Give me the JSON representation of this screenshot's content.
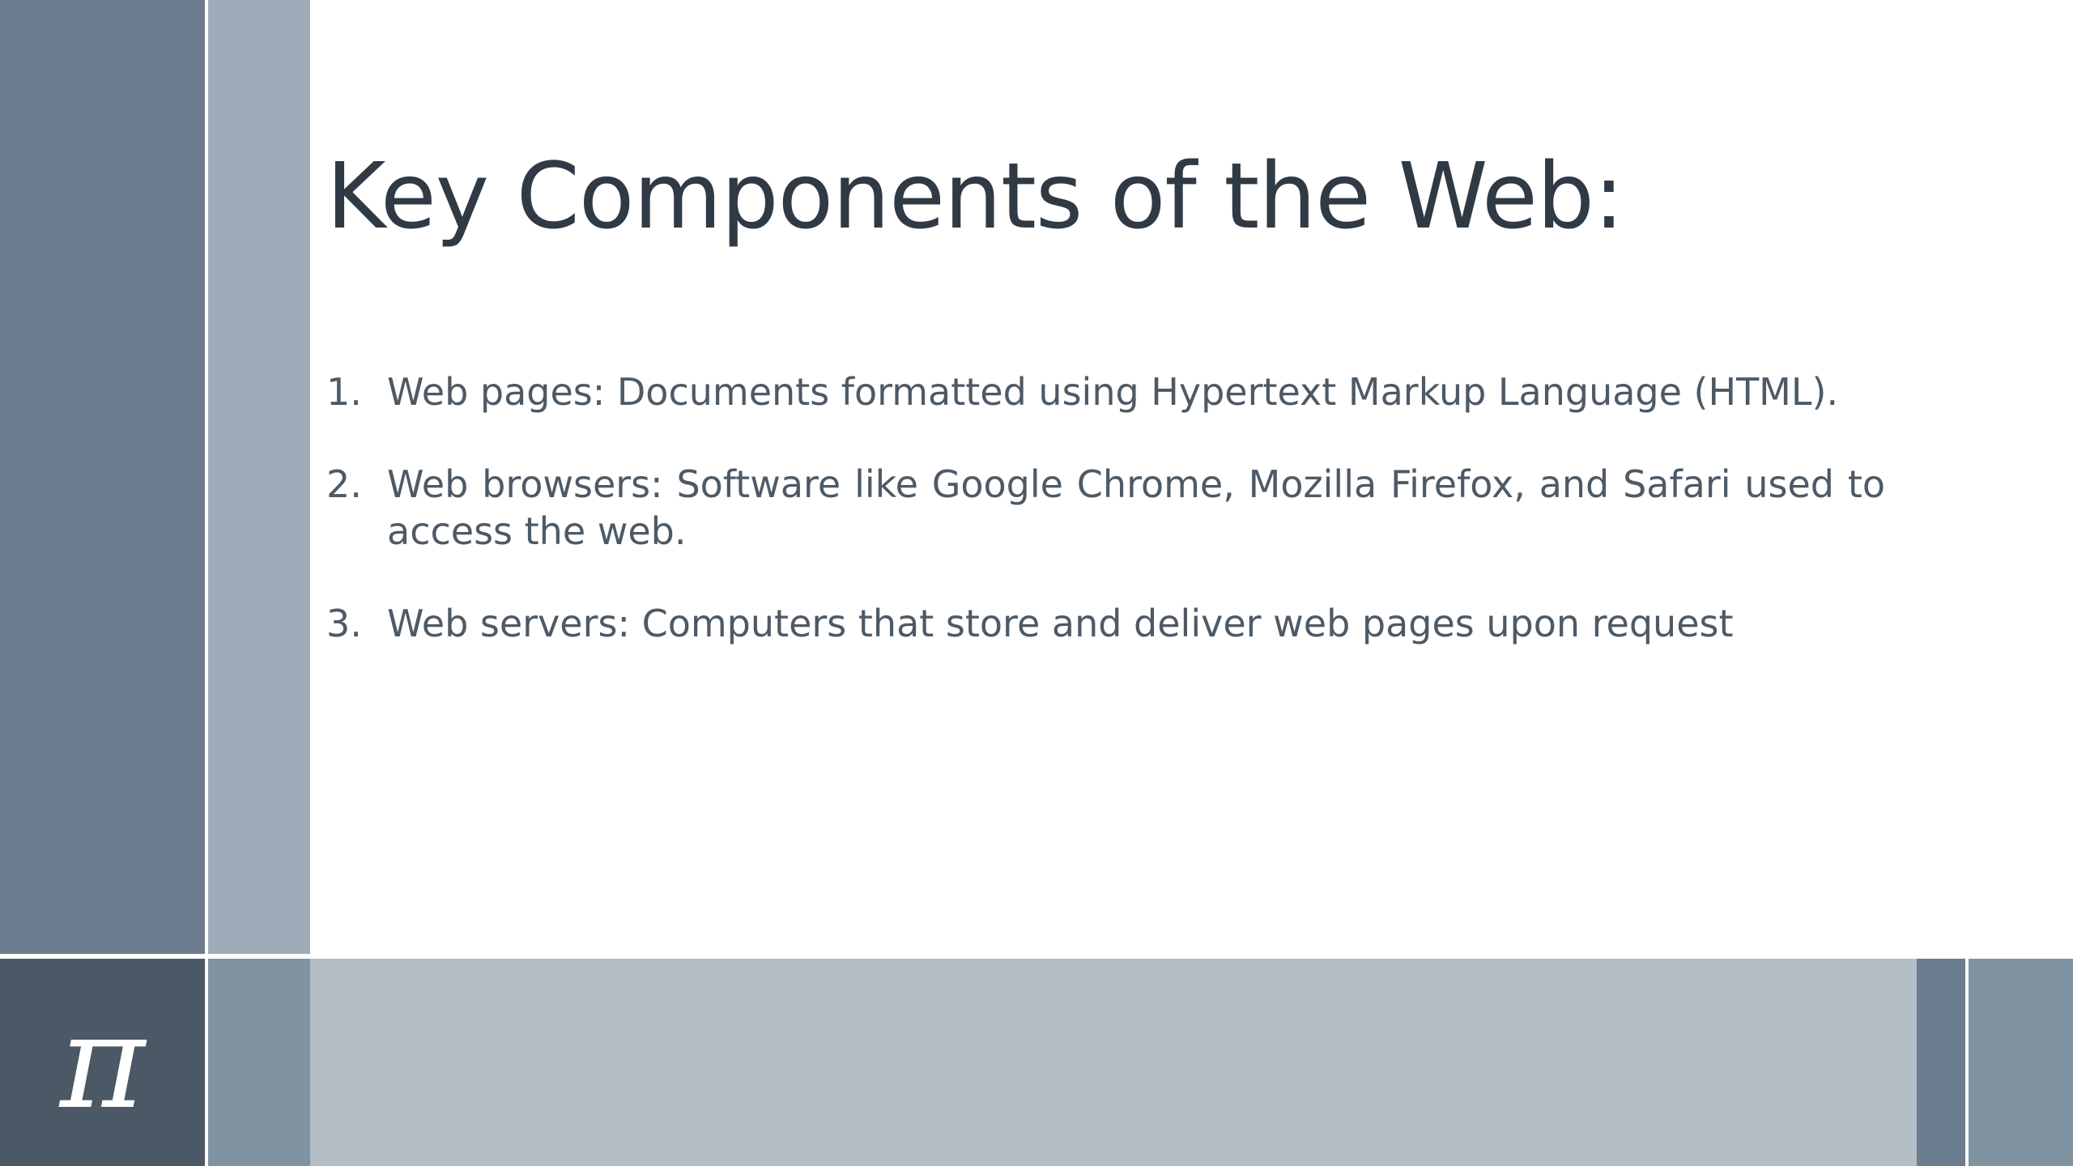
{
  "slide": {
    "title": "Key Components of the Web:",
    "logo_glyph": "π",
    "items": [
      {
        "number": "1.",
        "text": "Web pages: Documents formatted using Hypertext Markup Language (HTML)."
      },
      {
        "number": "2.",
        "text": "Web browsers: Software like Google Chrome, Mozilla Firefox, and Safari used to access the web."
      },
      {
        "number": "3.",
        "text": "Web servers: Computers that store and deliver web pages upon request"
      }
    ]
  },
  "colors": {
    "title": "#2f3a45",
    "body_text": "#4d5a66",
    "band_dark": "#6b7d8f",
    "band_light": "#9eabb8",
    "footer_logo": "#4b5966",
    "footer_bar": "#b3bec7"
  },
  "icons": {
    "logo": "pi-symbol-icon"
  }
}
